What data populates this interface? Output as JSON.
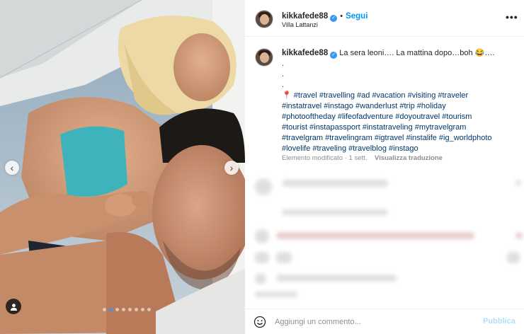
{
  "post": {
    "media": {
      "image_alt": "Couple selfie",
      "slide_count": 8,
      "active_slide": 2,
      "prev_icon": "chevron-left-icon",
      "next_icon": "chevron-right-icon",
      "tag_icon": "user-tag-icon"
    },
    "header": {
      "username": "kikkafede88",
      "verified": true,
      "separator": "•",
      "follow_label": "Segui",
      "location": "Villa Lattanzi",
      "more_icon": "more-options-icon"
    },
    "caption": {
      "username": "kikkafede88",
      "text": "La sera leoni…. La mattina dopo…boh 😂….",
      "dots": [
        ".",
        ".",
        "."
      ],
      "pin": "📍",
      "hashtag_lines": [
        "#travel #travelling #ad #vacation #visiting #traveler",
        "#instatravel #instago #wanderlust #trip #holiday",
        "#photooftheday #lifeofadventure #doyoutravel #tourism",
        "#tourist #instapassport #instatraveling #mytravelgram",
        "#travelgram #travelingram #igtravel #instalife #ig_worldphoto",
        "#lovelife #traveling #travelblog #instago"
      ],
      "edited_label": "Elemento modificato",
      "time": "1 sett.",
      "translate_label": "Visualizza traduzione"
    },
    "comment_box": {
      "placeholder": "Aggiungi un commento...",
      "publish_label": "Pubblica",
      "emoji_icon": "emoji-icon"
    }
  },
  "colors": {
    "accent": "#0095f6",
    "verified": "#3897f0",
    "hashtag": "#00376b",
    "muted": "#8e8e8e",
    "publish_disabled": "#b2dffc"
  }
}
